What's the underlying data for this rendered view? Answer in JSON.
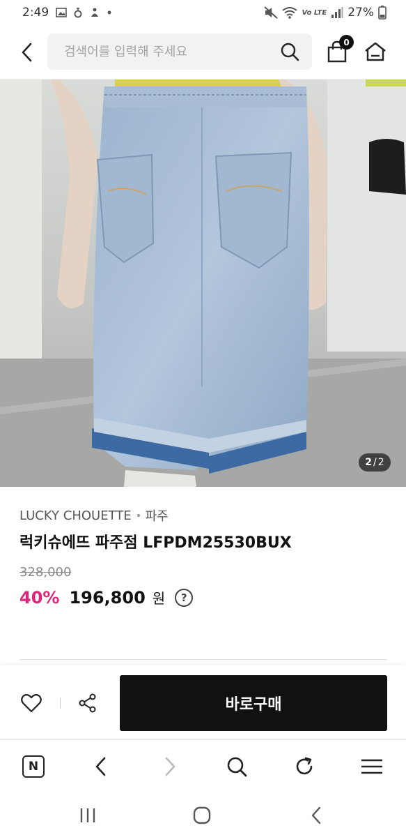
{
  "status_bar": {
    "time": "2:49",
    "network_label": "Vo LTE",
    "battery": "27%"
  },
  "header": {
    "search_placeholder": "검색어를 입력해 주세요",
    "cart_count": "0"
  },
  "gallery": {
    "current": "2",
    "separator": "/",
    "total": "2"
  },
  "product": {
    "brand": "LUCKY CHOUETTE",
    "store": "파주",
    "name": "럭키슈에뜨 파주점 LFPDM25530BUX",
    "original_price": "328,000",
    "discount": "40%",
    "sale_price": "196,800",
    "currency": "원",
    "help_symbol": "?"
  },
  "actions": {
    "buy_label": "바로구매"
  },
  "browser_nav": {
    "home_letter": "N"
  },
  "colors": {
    "accent": "#e0267a",
    "button_bg": "#111111"
  }
}
